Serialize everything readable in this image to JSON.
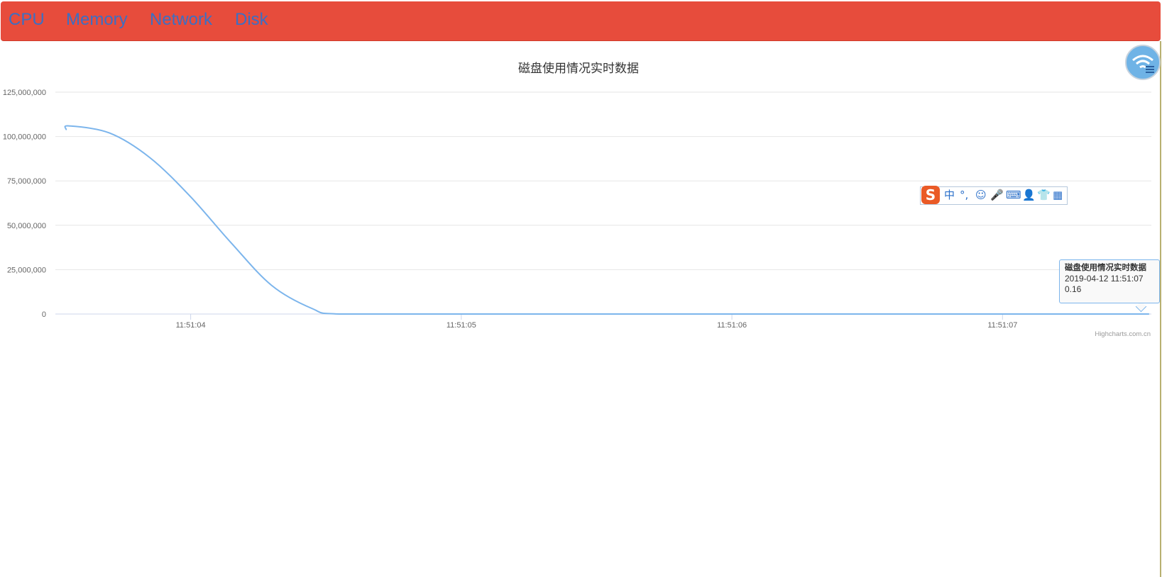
{
  "nav": {
    "items": [
      {
        "label": "CPU"
      },
      {
        "label": "Memory"
      },
      {
        "label": "Network"
      },
      {
        "label": "Disk"
      }
    ]
  },
  "ime_toolbar": {
    "logo": "S",
    "glyphs": [
      "中",
      "°,",
      "☺",
      "🎤",
      "⌨",
      "👤",
      "👕",
      "▦"
    ]
  },
  "tooltip": {
    "title": "磁盘使用情况实时数据",
    "timestamp": "2019-04-12 11:51:07",
    "value": "0.16"
  },
  "chart_data": {
    "type": "line",
    "title": "磁盘使用情况实时数据",
    "xlabel": "",
    "ylabel": "",
    "ylim": [
      0,
      125000000
    ],
    "xlim": [
      "11:51:03.50",
      "11:51:07.55"
    ],
    "y_ticks": [
      {
        "value": 0,
        "label": "0"
      },
      {
        "value": 25000000,
        "label": "25,000,000"
      },
      {
        "value": 50000000,
        "label": "50,000,000"
      },
      {
        "value": 75000000,
        "label": "75,000,000"
      },
      {
        "value": 100000000,
        "label": "100,000,000"
      },
      {
        "value": 125000000,
        "label": "125,000,000"
      }
    ],
    "x_ticks": [
      {
        "value": "11:51:04",
        "label": "11:51:04"
      },
      {
        "value": "11:51:05",
        "label": "11:51:05"
      },
      {
        "value": "11:51:06",
        "label": "11:51:06"
      },
      {
        "value": "11:51:07",
        "label": "11:51:07"
      }
    ],
    "grid": true,
    "legend": false,
    "series_color": "#7cb5ec",
    "series": [
      {
        "x": [
          "11:51:03.54",
          "11:51:03.55",
          "11:51:03.70",
          "11:51:03.85",
          "11:51:04.00",
          "11:51:04.15",
          "11:51:04.30",
          "11:51:04.45",
          "11:51:04.55",
          "11:51:05.00",
          "11:51:05.50",
          "11:51:06.00",
          "11:51:06.50",
          "11:51:07.00",
          "11:51:07.54"
        ],
        "values": [
          104000000,
          106000000,
          102000000,
          88000000,
          66000000,
          40000000,
          16000000,
          3000000,
          0,
          0,
          0,
          0,
          0,
          0,
          0.16
        ]
      }
    ],
    "credits": "Highcharts.com.cn"
  }
}
